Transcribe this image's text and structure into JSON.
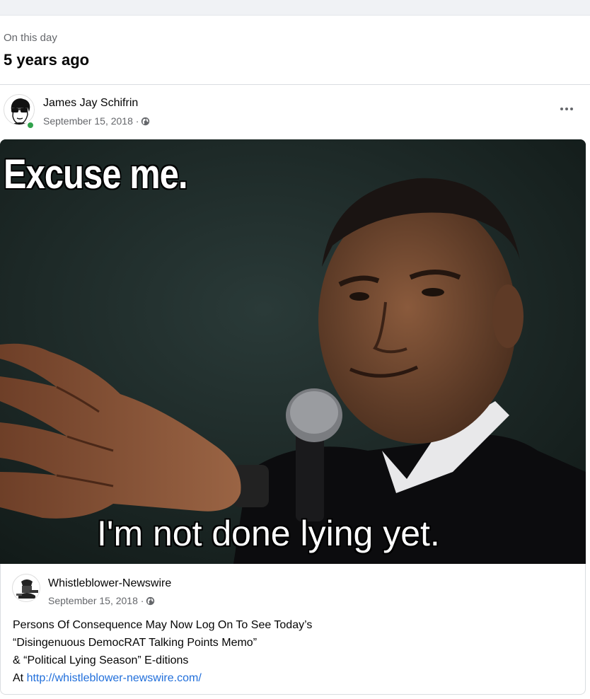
{
  "on_this_day": {
    "label": "On this day",
    "years_ago": "5 years ago"
  },
  "post": {
    "author": "James Jay Schifrin",
    "date": "September 15, 2018 ·",
    "privacy_icon": "globe-icon",
    "more_icon": "more-options-icon",
    "image": {
      "top_caption": "Excuse me.",
      "bottom_caption": "I'm not done lying yet."
    }
  },
  "shared_post": {
    "author": "Whistleblower-Newswire",
    "date": "September 15, 2018 ·",
    "lines": [
      "Persons Of Consequence May Now Log On To See Today’s",
      "“Disingenuous DemocRAT Talking Points Memo”",
      "& “Political Lying Season” E-ditions"
    ],
    "link_prefix": "At ",
    "link_text": "http://whistleblower-newswire.com/"
  },
  "colors": {
    "online": "#31a24c",
    "link": "#216fdb",
    "secondary_text": "#65676b"
  }
}
